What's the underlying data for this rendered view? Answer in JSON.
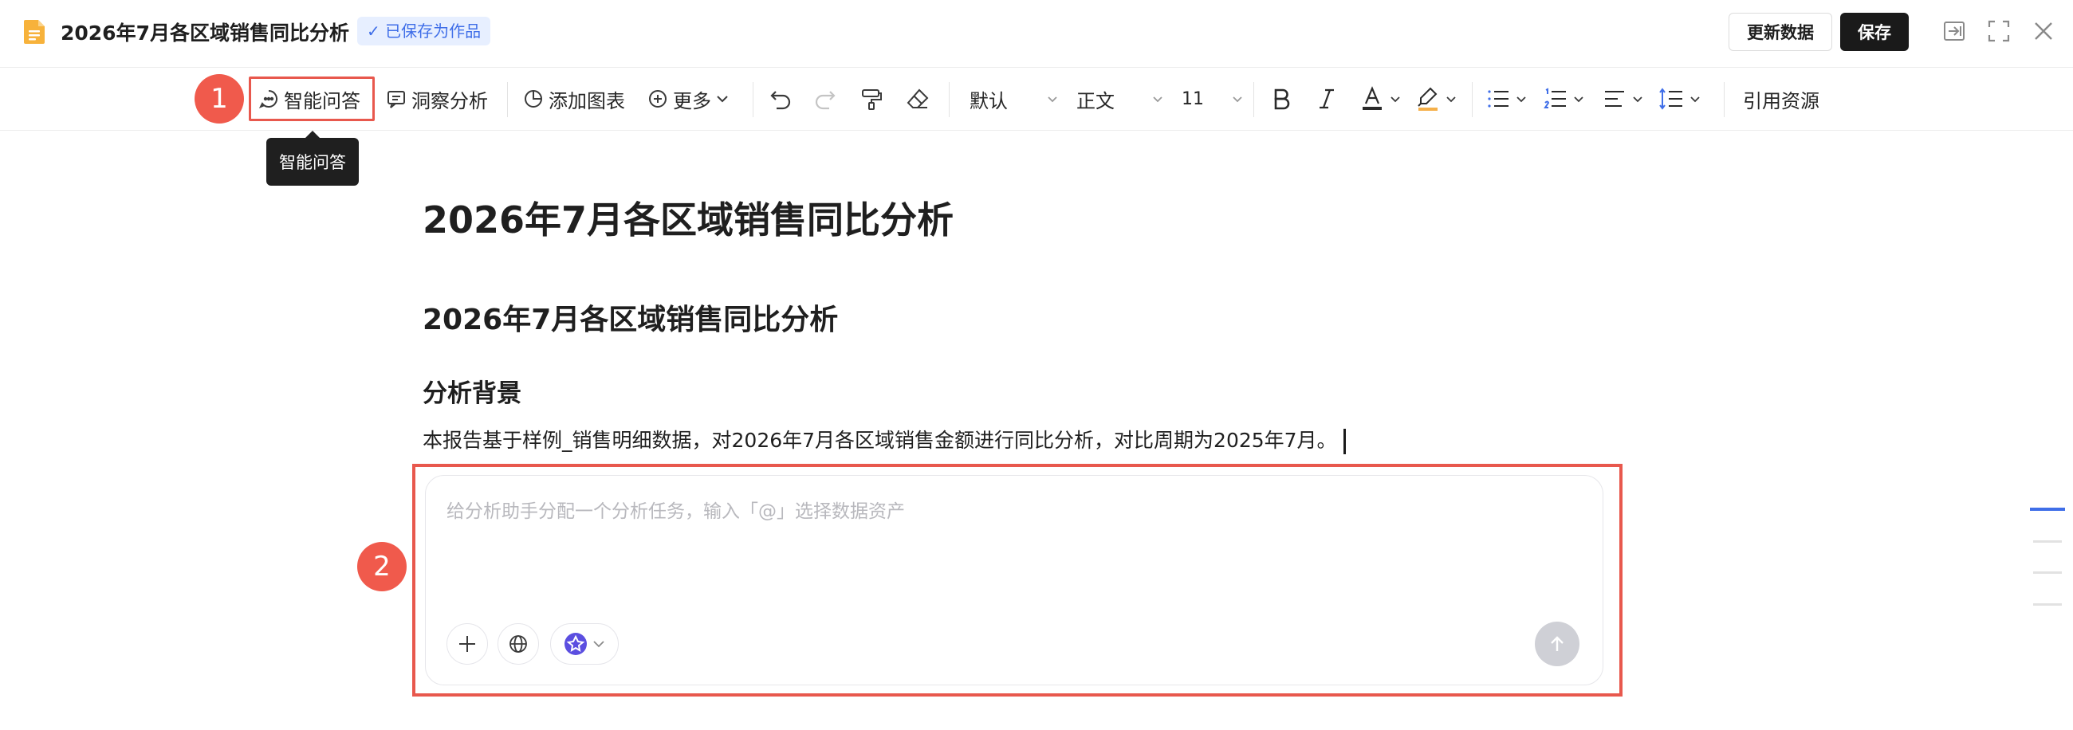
{
  "header": {
    "title": "2026年7月各区域销售同比分析",
    "saved_badge": "✓ 已保存为作品",
    "update_button": "更新数据",
    "save_button": "保存"
  },
  "toolbar": {
    "smart_qa": "智能问答",
    "insight": "洞察分析",
    "add_chart": "添加图表",
    "more": "更多",
    "font_family": "默认",
    "paragraph_style": "正文",
    "font_size": "11",
    "cite_resource": "引用资源"
  },
  "annotations": {
    "badge_1": "1",
    "badge_2": "2"
  },
  "tooltip": "智能问答",
  "document": {
    "h1": "2026年7月各区域销售同比分析",
    "h2": "2026年7月各区域销售同比分析",
    "h3": "分析背景",
    "paragraph": "本报告基于样例_销售明细数据，对2026年7月各区域销售金额进行同比分析，对比周期为2025年7月。"
  },
  "chat": {
    "placeholder": "给分析助手分配一个分析任务，输入「@」选择数据资产"
  },
  "colors": {
    "accent": "#3f6ee8",
    "highlight": "#e8584d",
    "badge": "#f05a4c",
    "dark_button": "#1a1a1a"
  },
  "icons": [
    "doc-icon",
    "exit-icon",
    "fullscreen-icon",
    "close-icon",
    "chat-bubble-icon",
    "comment-icon",
    "pie-chart-icon",
    "plus-circle-icon",
    "undo-icon",
    "redo-icon",
    "paint-roller-icon",
    "eraser-icon",
    "bold-icon",
    "italic-icon",
    "font-color-icon",
    "highlight-icon",
    "bullet-list-icon",
    "numbered-list-icon",
    "align-icon",
    "line-height-icon",
    "plus-icon",
    "globe-icon",
    "model-icon",
    "send-icon"
  ]
}
